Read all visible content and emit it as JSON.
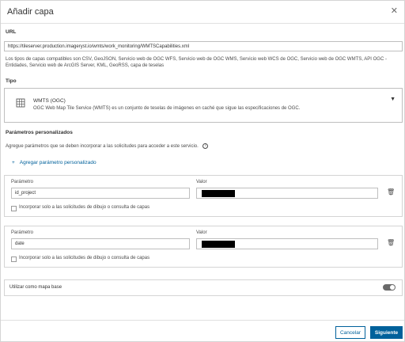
{
  "dialog": {
    "title": "Añadir capa",
    "close_icon": "close-icon"
  },
  "url_section": {
    "label": "URL",
    "value": "https://tileserver.production.imageryst.io/wmts/work_monitoring/WMTSCapabilities.xml",
    "help": "Los tipos de capas compatibles son CSV, GeoJSON, Servicio web de OGC WFS, Servicio web de OGC WMS, Servicio web WCS de OGC, Servicio web de OGC WMTS, API OGC - Entidades, Servicio web de ArcGIS Server, KML, GeoRSS, capa de teselas"
  },
  "type_section": {
    "label": "Tipo",
    "name": "WMTS (OGC)",
    "description": "OGC Web Map Tile Service (WMTS) es un conjunto de teselas de imágenes en caché que sigue las especificaciones de OGC.",
    "icon": "layer-tiles-icon"
  },
  "custom_params": {
    "label": "Parámetros personalizados",
    "help": "Agregue parámetros que se deben incorporar a las solicitudes para acceder a este servicio.",
    "add_label": "Agregar parámetro personalizado",
    "rows": [
      {
        "param_label": "Parámetro",
        "param_value": "id_project",
        "value_label": "Valor",
        "value_masked": true,
        "checkbox_label": "Incorporar solo a las solicitudes de dibujo o consulta de capas",
        "checked": false
      },
      {
        "param_label": "Parámetro",
        "param_value": "date",
        "value_label": "Valor",
        "value_masked": true,
        "checkbox_label": "Incorporar solo a las solicitudes de dibujo o consulta de capas",
        "checked": false
      }
    ]
  },
  "basemap": {
    "label": "Utilizar como mapa base",
    "enabled": false
  },
  "footer": {
    "cancel_label": "Cancelar",
    "next_label": "Siguiente"
  },
  "colors": {
    "accent": "#00619b",
    "border": "#bfbfbf",
    "text": "#323232"
  }
}
